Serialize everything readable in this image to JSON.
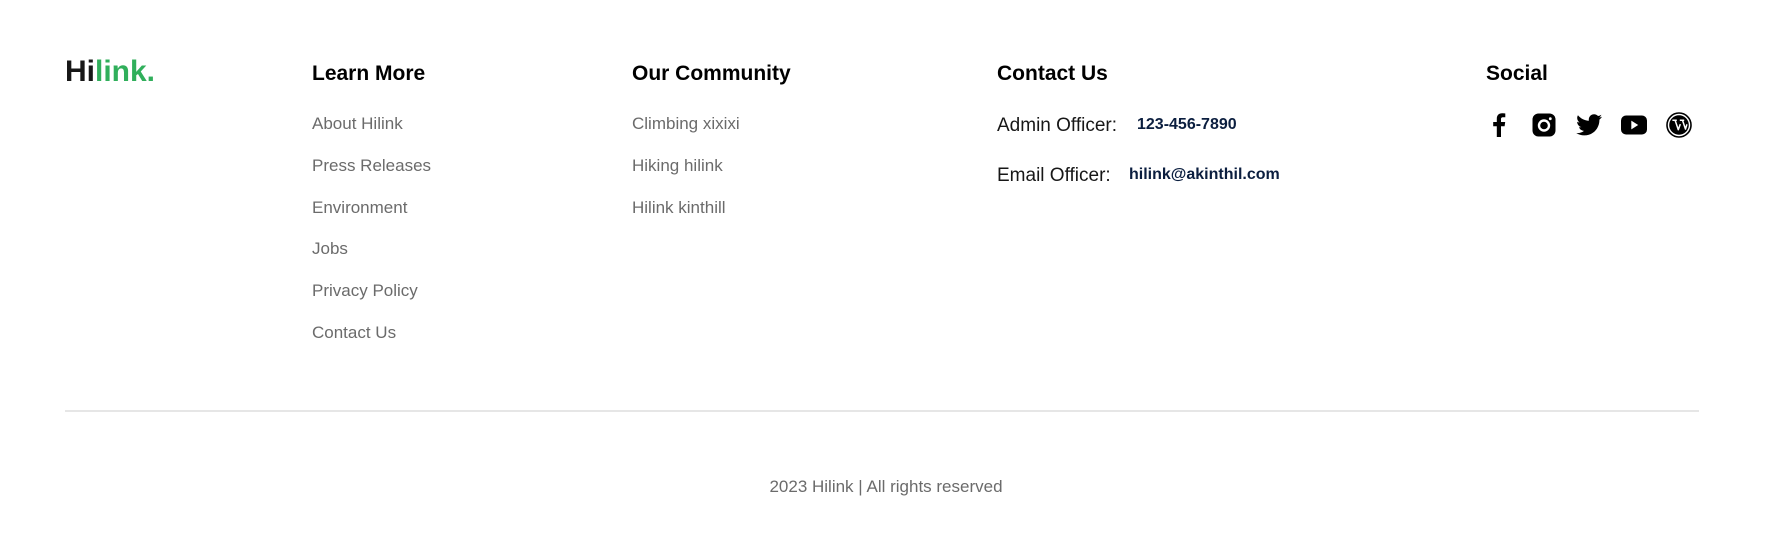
{
  "logo": {
    "part_dark": "Hi",
    "part_green": "link.",
    "accent_color": "#30af5b"
  },
  "learn_more": {
    "title": "Learn More",
    "links": [
      "About Hilink",
      "Press Releases",
      "Environment",
      "Jobs",
      "Privacy Policy",
      "Contact Us"
    ]
  },
  "community": {
    "title": "Our Community",
    "links": [
      "Climbing xixixi",
      "Hiking hilink",
      "Hilink kinthill"
    ]
  },
  "contact": {
    "title": "Contact Us",
    "items": [
      {
        "label": "Admin Officer:",
        "value": "123-456-7890"
      },
      {
        "label": "Email Officer:",
        "value": "hilink@akinthil.com"
      }
    ]
  },
  "social": {
    "title": "Social",
    "icons": [
      "facebook-icon",
      "instagram-icon",
      "twitter-icon",
      "youtube-icon",
      "wordpress-icon"
    ]
  },
  "footer": {
    "copyright": "2023 Hilink | All rights reserved"
  }
}
